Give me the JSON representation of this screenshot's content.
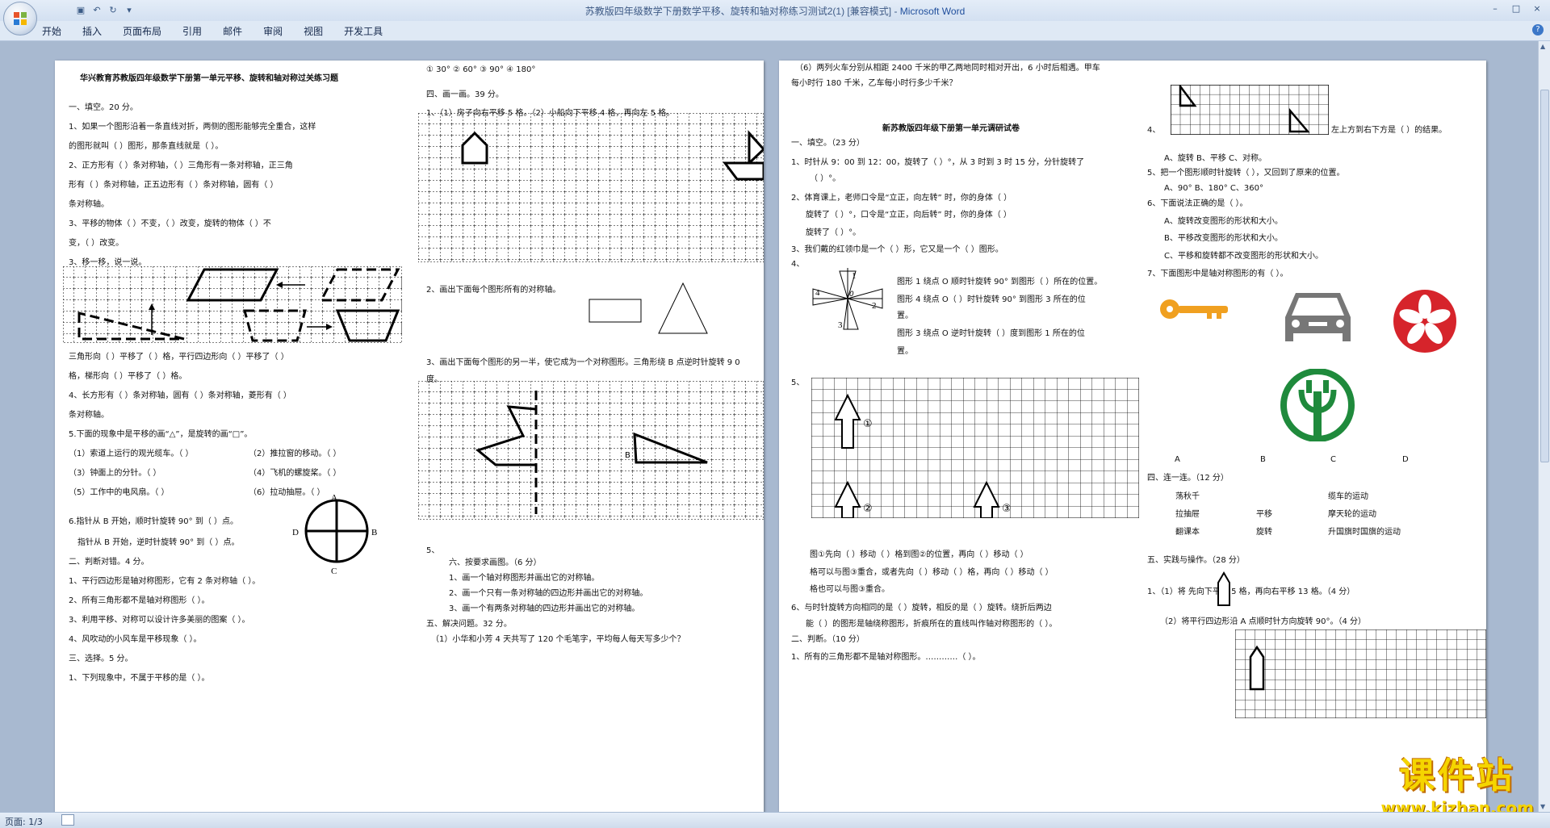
{
  "window": {
    "title": "苏教版四年级数学下册数学平移、旋转和轴对称练习测试2(1) [兼容模式]",
    "app": "Microsoft Word",
    "controls": [
      "–",
      "□",
      "×"
    ]
  },
  "ribbon": {
    "tabs": [
      "开始",
      "插入",
      "页面布局",
      "引用",
      "邮件",
      "审阅",
      "视图",
      "开发工具"
    ],
    "help": "?"
  },
  "status": {
    "page": "页面: 1/3"
  },
  "page1": {
    "title": "华兴教育苏教版四年级数学下册第一单元平移、旋转和轴对称过关练习题",
    "lines": [
      "一、填空。20 分。",
      "1、如果一个图形沿着一条直线对折，两侧的图形能够完全重合，这样",
      "的图形就叫（    ）图形，那条直线就是（      ）。",
      "2、正方形有（      ）条对称轴，（      ）三角形有一条对称轴，正三角",
      "形有（      ）条对称轴，正五边形有（      ）条对称轴，圆有（      ）",
      "条对称轴。",
      "3、平移的物体（      ）不变，（      ）改变，旋转的物体（      ）不",
      "变，（      ）改变。",
      "3、移一移，说一说。",
      "三角形向（    ）平移了（    ）格，平行四边形向（    ）平移了（    ）",
      "格，梯形向（    ）平移了（    ）格。",
      "4、长方形有（      ）条对称轴，圆有（      ）条对称轴，菱形有（      ）",
      "条对称轴。",
      "5.下面的现象中是平移的画“△”，是旋转的画“□”。",
      "（1）索道上运行的观光缆车。（      ）",
      "（2）推拉窗的移动。（      ）",
      "（3）钟面上的分针。（      ）",
      "（4）飞机的螺旋桨。（      ）",
      "（5）工作中的电风扇。（      ）",
      "（6）拉动抽屉。（      ）",
      "6.指针从 B 开始，顺时针旋转 90° 到（    ）点。",
      "指针从 B 开始，逆时针旋转 90° 到（    ）点。",
      "二、判断对错。4 分。",
      "1、平行四边形是轴对称图形，它有 2 条对称轴（    ）。",
      "2、所有三角形都不是轴对称图形（    ）。",
      "3、利用平移、对称可以设计许多美丽的图案（    ）。",
      "4、风吹动的小风车是平移现象（    ）。",
      "三、选择。5 分。",
      "1、下列现象中，不属于平移的是（    ）。"
    ],
    "clock_labels": [
      "A",
      "B",
      "C",
      "D"
    ]
  },
  "page2": {
    "lines": [
      "① 30°      ② 60°      ③ 90°      ④ 180°",
      "四、画一画。39 分。",
      "1、（1）房子向右平移 5 格。（2）小船向下平移 4 格，再向左 5 格。",
      "2、画出下面每个图形所有的对称轴。",
      "3、画出下面每个图形的另一半，使它成为一个对称图形。三角形绕 B 点逆时针旋转 9 0",
      "度。",
      "5、",
      "六、按要求画图。（6 分）",
      "1、画一个轴对称图形并画出它的对称轴。",
      "2、画一个只有一条对称轴的四边形并画出它的对称轴。",
      "3、画一个有两条对称轴的四边形并画出它的对称轴。",
      "五、解决问题。32 分。",
      "（1）小华和小芳 4 天共写了 120 个毛笔字，平均每人每天写多少个？"
    ],
    "point_label": "B"
  },
  "page3": {
    "lines": [
      "（6）两列火车分别从相距 2400 千米的甲乙两地同时相对开出，6 小时后相遇。甲车",
      "每小时行 180 千米，乙车每小时行多少千米？",
      "新苏教版四年级下册第一单元调研试卷",
      "一、填空。（23 分）",
      "1、时针从 9：00 到 12：00，旋转了（      ）°，从 3 时到 3 时 15 分，分针旋转了",
      "（      ）°。",
      "2、体育课上，老师口令是“立正，向左转”  时，你的身体（      ）",
      "旋转了（      ）°，口令是“立正，向后转”  时，你的身体（      ）",
      "旋转了（      ）°。",
      "3、我们戴的红领巾是一个（      ）形，它又是一个（        ）图形。",
      "4、",
      "图形 1 绕点 O 顺时针旋转 90° 到图形（      ）所在的位置。",
      "图形 4 绕点 O（        ）时针旋转 90° 到图形 3 所在的位",
      "置。",
      "图形 3 绕点 O 逆时针旋转（        ）度到图形 1 所在的位",
      "置。",
      "5、",
      "图①先向（    ）移动（    ）格到图②的位置，再向（    ）移动（    ）",
      "格可以与图③重合，或者先向（    ）移动（    ）格，再向（    ）移动（    ）",
      "格也可以与图③重合。",
      "6、与时针旋转方向相同的是（      ）旋转，相反的是（      ）旋转。绕折后两边",
      "能（        ）的图形是轴绕称图形，折痕所在的直线叫作轴对称图形的（      ）。",
      "二、判断。（10 分）",
      "1、所有的三角形都不是轴对称图形。…………（    ）。"
    ],
    "pinwheel_labels": [
      "1",
      "2",
      "3",
      "4",
      "0"
    ],
    "arrow_labels": [
      "①",
      "②",
      "③"
    ]
  },
  "page4": {
    "lines": [
      "4、",
      "左上方到右下方是（      ）的结果。",
      "A、旋转              B、平移              C、对称。",
      "5、把一个图形顺时针旋转（    ），又回到了原来的位置。",
      "A、90°           B、180°           C、360°",
      "6、下面说法正确的是（    ）。",
      "A、旋转改变图形的形状和大小。",
      "B、平移改变图形的形状和大小。",
      "C、平移和旋转都不改变图形的形状和大小。",
      "7、下面图形中是轴对称图形的有（        ）。",
      "四、连一连。（12 分）",
      "荡秋千",
      "拉抽屉",
      "翻课本",
      "平移",
      "旋转",
      "缆车的运动",
      "摩天轮的运动",
      "升国旗时国旗的运动",
      "五、实践与操作。（28 分）",
      "1、（1）将        先向下平移 5 格，再向右平移 13 格。（4 分）",
      "（2）将平行四边形沿 A 点顺时针方向旋转 90°。（4 分）"
    ],
    "option_labels": [
      "A",
      "B",
      "C",
      "D"
    ]
  },
  "watermark": {
    "brand": "课件站",
    "url": "www.kjzhan.com"
  }
}
